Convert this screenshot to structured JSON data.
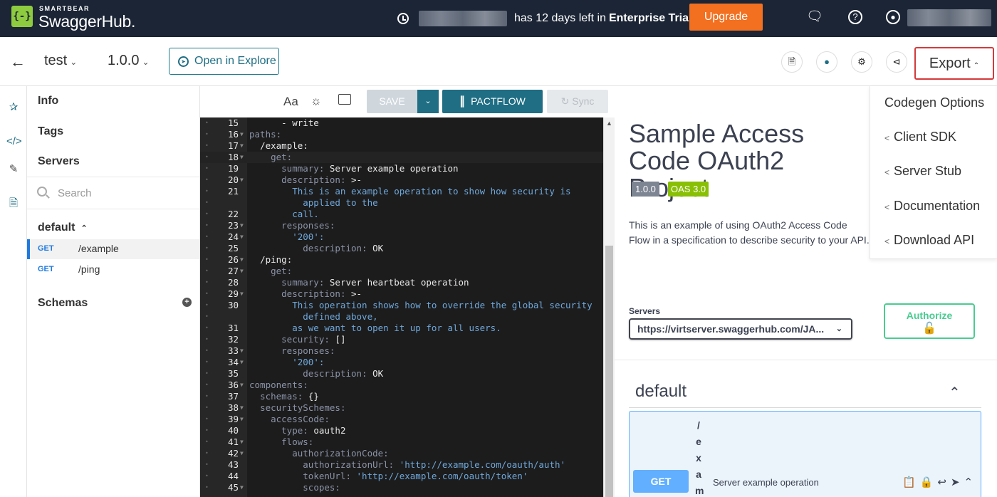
{
  "topbar": {
    "brand_small": "SMARTBEAR",
    "brand": "SwaggerHub.",
    "logo_glyph": "{-}",
    "trial_text": "has 12 days left in",
    "trial_plan": "Enterprise Trial",
    "upgrade_label": "Upgrade",
    "icons": [
      "clock-icon",
      "chat-icon",
      "help-icon",
      "user-icon"
    ]
  },
  "subbar": {
    "api_name": "test",
    "version": "1.0.0",
    "open_explore_label": "Open in Explore",
    "export_label": "Export"
  },
  "nav": {
    "info": "Info",
    "tags": "Tags",
    "servers": "Servers",
    "search_placeholder": "Search",
    "group": "default",
    "operations": [
      {
        "method": "GET",
        "path": "/example"
      },
      {
        "method": "GET",
        "path": "/ping"
      }
    ],
    "schemas": "Schemas"
  },
  "editor_toolbar": {
    "font_label": "Aa",
    "save_label": "SAVE",
    "pactflow_label": "PACTFLOW",
    "sync_label": "Sync"
  },
  "editor_lines": [
    {
      "n": "15",
      "t": "      - write",
      "fold": false
    },
    {
      "n": "16",
      "t": "paths:",
      "fold": true
    },
    {
      "n": "17",
      "t": "  /example:",
      "fold": true
    },
    {
      "n": "18",
      "t": "    get:",
      "fold": true
    },
    {
      "n": "19",
      "t": "      summary: Server example operation",
      "fold": false
    },
    {
      "n": "20",
      "t": "      description: >-",
      "fold": true
    },
    {
      "n": "21",
      "t": "        This is an example operation to show how security is",
      "fold": false
    },
    {
      "n": "",
      "t": "          applied to the",
      "fold": false
    },
    {
      "n": "22",
      "t": "        call.",
      "fold": false
    },
    {
      "n": "23",
      "t": "      responses:",
      "fold": true
    },
    {
      "n": "24",
      "t": "        '200':",
      "fold": true
    },
    {
      "n": "25",
      "t": "          description: OK",
      "fold": false
    },
    {
      "n": "26",
      "t": "  /ping:",
      "fold": true
    },
    {
      "n": "27",
      "t": "    get:",
      "fold": true
    },
    {
      "n": "28",
      "t": "      summary: Server heartbeat operation",
      "fold": false
    },
    {
      "n": "29",
      "t": "      description: >-",
      "fold": true
    },
    {
      "n": "30",
      "t": "        This operation shows how to override the global security",
      "fold": false
    },
    {
      "n": "",
      "t": "          defined above,",
      "fold": false
    },
    {
      "n": "31",
      "t": "        as we want to open it up for all users.",
      "fold": false
    },
    {
      "n": "32",
      "t": "      security: []",
      "fold": false
    },
    {
      "n": "33",
      "t": "      responses:",
      "fold": true
    },
    {
      "n": "34",
      "t": "        '200':",
      "fold": true
    },
    {
      "n": "35",
      "t": "          description: OK",
      "fold": false
    },
    {
      "n": "36",
      "t": "components:",
      "fold": true
    },
    {
      "n": "37",
      "t": "  schemas: {}",
      "fold": false
    },
    {
      "n": "38",
      "t": "  securitySchemes:",
      "fold": true
    },
    {
      "n": "39",
      "t": "    accessCode:",
      "fold": true
    },
    {
      "n": "40",
      "t": "      type: oauth2",
      "fold": false
    },
    {
      "n": "41",
      "t": "      flows:",
      "fold": true
    },
    {
      "n": "42",
      "t": "        authorizationCode:",
      "fold": true
    },
    {
      "n": "43",
      "t": "          authorizationUrl: 'http://example.com/oauth/auth'",
      "fold": false
    },
    {
      "n": "44",
      "t": "          tokenUrl: 'http://example.com/oauth/token'",
      "fold": false
    },
    {
      "n": "45",
      "t": "          scopes:",
      "fold": true
    }
  ],
  "preview": {
    "title": "Sample Access Code OAuth2 Project",
    "version_badge": "1.0.0",
    "oas_badge": "OAS 3.0",
    "description": "This is an example of using OAuth2 Access Code Flow in a specification to describe security to your API.",
    "servers_label": "Servers",
    "server_value": "https://virtserver.swaggerhub.com/JA...",
    "authorize_label": "Authorize",
    "group_title": "default",
    "op_method": "GET",
    "op_path": "/exam",
    "op_summary": "Server example operation"
  },
  "export_menu": {
    "items": [
      "Codegen Options",
      "Client SDK",
      "Server Stub",
      "Documentation",
      "Download API"
    ]
  },
  "colors": {
    "topbar": "#1b2535",
    "accent": "#1f6e84",
    "upgrade": "#f2701f",
    "get": "#61affe",
    "authorize": "#49cc90",
    "export_highlight": "#d43a3a"
  }
}
